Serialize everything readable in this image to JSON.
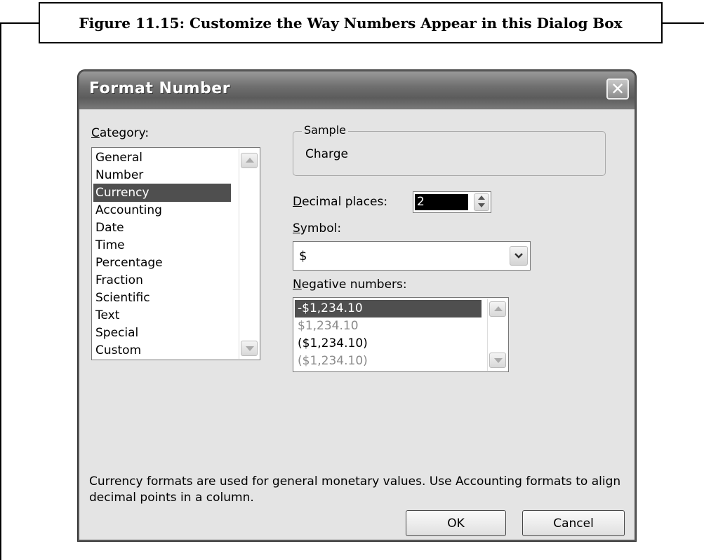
{
  "caption": "Figure 11.15: Customize the Way Numbers Appear in this Dialog Box",
  "dialog": {
    "title": "Format Number",
    "close_glyph": "✕",
    "category_label_u": "C",
    "category_label_rest": "ategory:",
    "categories": [
      "General",
      "Number",
      "Currency",
      "Accounting",
      "Date",
      "Time",
      "Percentage",
      "Fraction",
      "Scientific",
      "Text",
      "Special",
      "Custom"
    ],
    "selected_category": "Currency",
    "sample_label": "Sample",
    "sample_value": "Charge",
    "decimal_label_u": "D",
    "decimal_label_rest": "ecimal places:",
    "decimal_value": "2",
    "symbol_label_u": "S",
    "symbol_label_rest": "ymbol:",
    "symbol_value": "$",
    "negative_label_u": "N",
    "negative_label_rest": "egative numbers:",
    "negative_options": [
      "-$1,234.10",
      "$1,234.10",
      "($1,234.10)",
      "($1,234.10)"
    ],
    "description": "Currency formats are used for general monetary values.  Use Accounting formats to align decimal points in a column.",
    "ok_label": "OK",
    "cancel_label": "Cancel"
  }
}
